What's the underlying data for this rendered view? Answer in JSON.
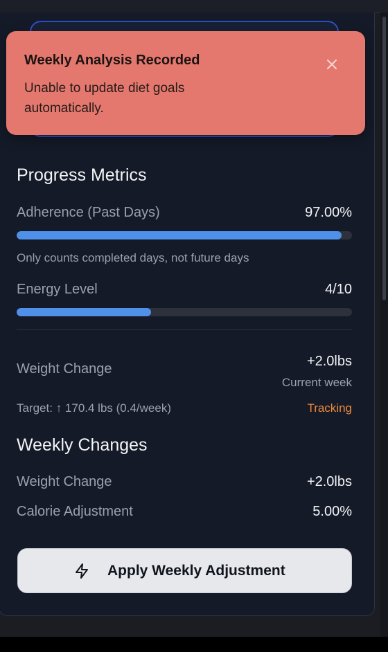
{
  "toast": {
    "title": "Weekly Analysis Recorded",
    "message": "Unable to update diet goals automatically.",
    "close_icon": "close-icon",
    "background": "#e5786e"
  },
  "progress": {
    "title": "Progress Metrics",
    "adherence": {
      "label": "Adherence (Past Days)",
      "value": "97.00%",
      "fraction": 0.97,
      "note": "Only counts completed days, not future days"
    },
    "energy": {
      "label": "Energy Level",
      "value": "4/10",
      "fraction": 0.4
    },
    "weight": {
      "label": "Weight Change",
      "value": "+2.0lbs",
      "period": "Current week",
      "target": "Target: ↑ 170.4 lbs (0.4/week)",
      "status": "Tracking"
    }
  },
  "weekly": {
    "title": "Weekly Changes",
    "weight_label": "Weight Change",
    "weight_value": "+2.0lbs",
    "calorie_label": "Calorie Adjustment",
    "calorie_value": "5.00%"
  },
  "actions": {
    "apply_label": "Apply Weekly Adjustment",
    "apply_icon": "lightning-icon"
  },
  "colors": {
    "accent_bar": "#4f90e8",
    "status_tracking": "#f08a3c",
    "card_background": "#141a28"
  }
}
